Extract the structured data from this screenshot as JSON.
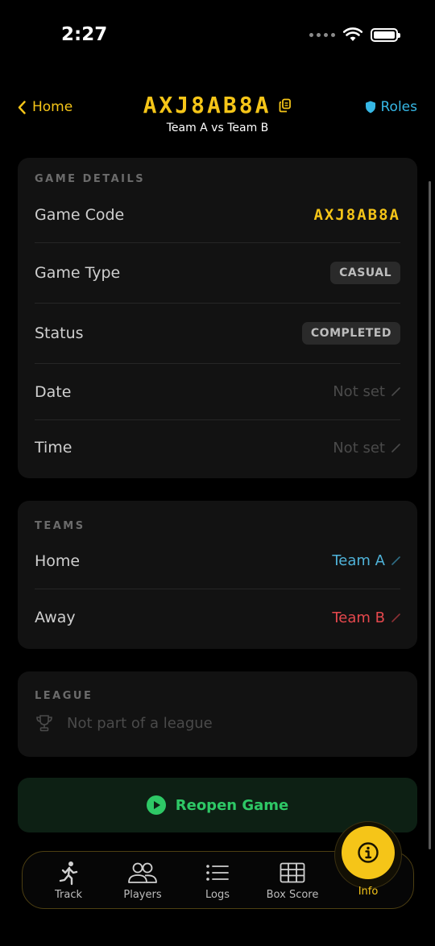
{
  "status_bar": {
    "time": "2:27"
  },
  "header": {
    "back_label": "Home",
    "game_code": "AXJ8AB8A",
    "subtitle": "Team A vs Team B",
    "roles_label": "Roles",
    "accent_color": "#f5c518",
    "roles_color": "#36b8e6"
  },
  "game_details": {
    "section_label": "GAME DETAILS",
    "rows": [
      {
        "label": "Game Code",
        "value": "AXJ8AB8A"
      },
      {
        "label": "Game Type",
        "value": "CASUAL"
      },
      {
        "label": "Status",
        "value": "COMPLETED"
      },
      {
        "label": "Date",
        "value": "Not set"
      },
      {
        "label": "Time",
        "value": "Not set"
      }
    ]
  },
  "teams": {
    "section_label": "TEAMS",
    "rows": [
      {
        "label": "Home",
        "value": "Team A",
        "color": "#4fb3d9"
      },
      {
        "label": "Away",
        "value": "Team B",
        "color": "#e5484d"
      }
    ]
  },
  "league": {
    "section_label": "LEAGUE",
    "value": "Not part of a league",
    "icon": "trophy-icon"
  },
  "actions": {
    "reopen_label": "Reopen Game",
    "reopen_color": "#2ec866"
  },
  "tabs": [
    {
      "label": "Track",
      "icon": "running-person-icon"
    },
    {
      "label": "Players",
      "icon": "people-icon"
    },
    {
      "label": "Logs",
      "icon": "list-icon"
    },
    {
      "label": "Box Score",
      "icon": "table-icon"
    },
    {
      "label": "Info",
      "icon": "info-icon",
      "active": true
    }
  ]
}
